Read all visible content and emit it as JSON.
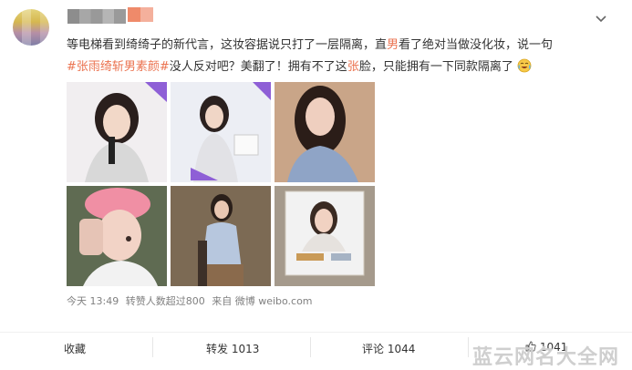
{
  "post": {
    "line1": "等电梯看到绮绮子的新代言，这妆容据说只打了一层隔离，直",
    "line1_hl": "男",
    "line1_tail": "看了绝对当做没化妆，说一句",
    "hashtag": "#张雨绮斩男素颜#",
    "line2_mid": "没人反对吧？美翻了！拥有不了这",
    "line2_hl": "张",
    "line2_tail": "脸，只能拥有一下同款隔离了"
  },
  "meta": {
    "time": "今天 13:49",
    "reposts_note": "转赞人数超过800",
    "source": "来自 微博 weibo.com"
  },
  "actions": {
    "favorite": "收藏",
    "repost": "转发 1013",
    "comment": "评论 1044",
    "like": "1041"
  },
  "watermark": "蓝云网名大全网",
  "icons": [
    "chevron-down-icon",
    "laugh-cry-emoji-icon",
    "like-thumb-icon"
  ]
}
